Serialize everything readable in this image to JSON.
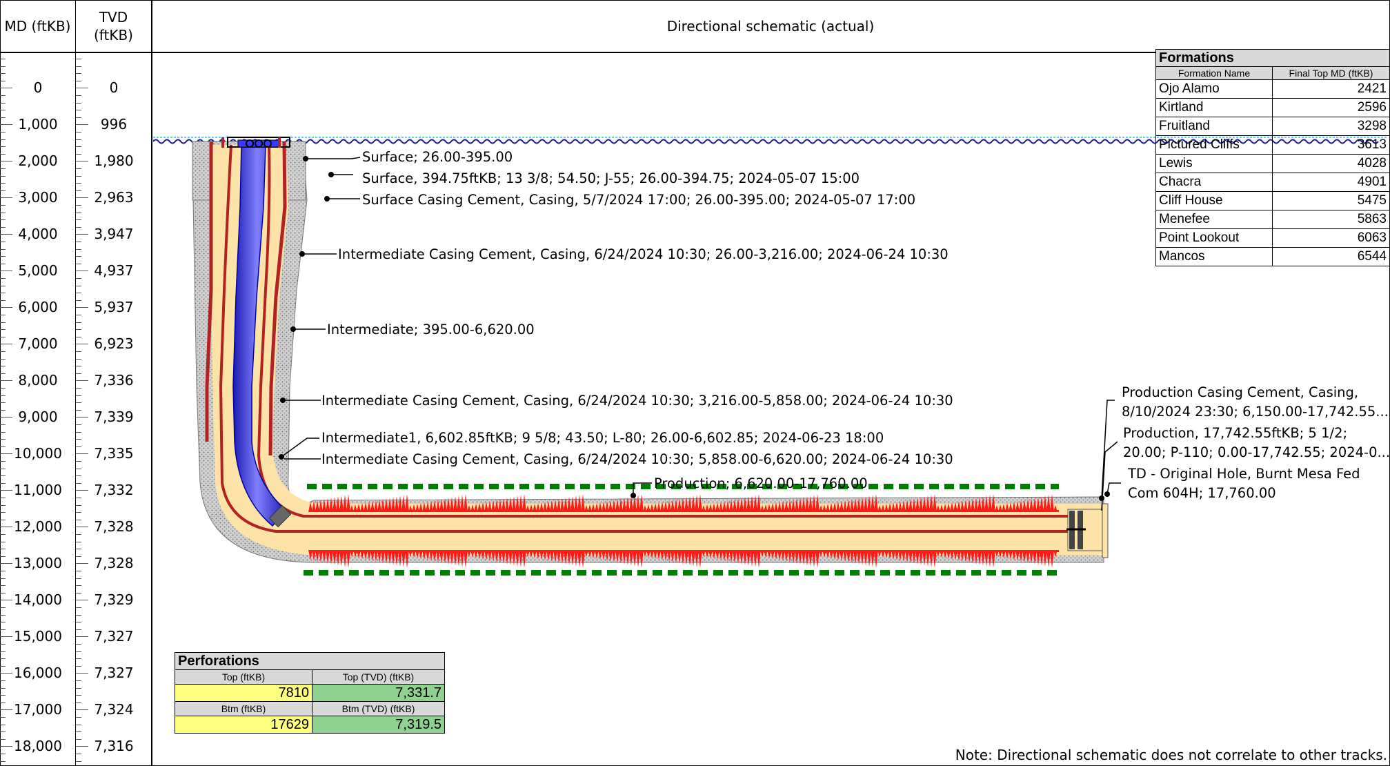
{
  "headers": {
    "md": "MD (ftKB)",
    "tvd_line1": "TVD",
    "tvd_line2": "(ftKB)",
    "schematic": "Directional schematic (actual)"
  },
  "depth_rows": [
    {
      "md": "0",
      "tvd": "0"
    },
    {
      "md": "1,000",
      "tvd": "996"
    },
    {
      "md": "2,000",
      "tvd": "1,980"
    },
    {
      "md": "3,000",
      "tvd": "2,963"
    },
    {
      "md": "4,000",
      "tvd": "3,947"
    },
    {
      "md": "5,000",
      "tvd": "4,937"
    },
    {
      "md": "6,000",
      "tvd": "5,937"
    },
    {
      "md": "7,000",
      "tvd": "6,923"
    },
    {
      "md": "8,000",
      "tvd": "7,336"
    },
    {
      "md": "9,000",
      "tvd": "7,339"
    },
    {
      "md": "10,000",
      "tvd": "7,335"
    },
    {
      "md": "11,000",
      "tvd": "7,332"
    },
    {
      "md": "12,000",
      "tvd": "7,328"
    },
    {
      "md": "13,000",
      "tvd": "7,328"
    },
    {
      "md": "14,000",
      "tvd": "7,329"
    },
    {
      "md": "15,000",
      "tvd": "7,327"
    },
    {
      "md": "16,000",
      "tvd": "7,327"
    },
    {
      "md": "17,000",
      "tvd": "7,324"
    },
    {
      "md": "18,000",
      "tvd": "7,316"
    }
  ],
  "callouts": {
    "surface_hole": "Surface; 26.00-395.00",
    "surface_casing": "Surface, 394.75ftKB; 13 3/8; 54.50; J-55; 26.00-394.75; 2024-05-07 15:00",
    "surface_cement": "Surface Casing Cement, Casing, 5/7/2024 17:00; 26.00-395.00; 2024-05-07 17:00",
    "int_cement_1": "Intermediate Casing Cement, Casing, 6/24/2024 10:30; 26.00-3,216.00; 2024-06-24 10:30",
    "intermediate_hole": "Intermediate; 395.00-6,620.00",
    "int_cement_2": "Intermediate Casing Cement, Casing, 6/24/2024 10:30; 3,216.00-5,858.00; 2024-06-24 10:30",
    "intermediate1_casing": "Intermediate1, 6,602.85ftKB; 9 5/8; 43.50; L-80; 26.00-6,602.85; 2024-06-23 18:00",
    "int_cement_3": "Intermediate Casing Cement, Casing, 6/24/2024 10:30; 5,858.00-6,620.00; 2024-06-24 10:30",
    "production_hole": "Production; 6,620.00-17,760.00",
    "prod_cement_l1": "Production Casing Cement, Casing,",
    "prod_cement_l2": "8/10/2024  23:30;  6,150.00-17,742.55...",
    "prod_casing_l1": "Production, 17,742.55ftKB; 5 1/2;",
    "prod_casing_l2": "20.00;  P-110;  0.00-17,742.55;  2024-0...",
    "td_l1": "TD - Original Hole, Burnt Mesa Fed",
    "td_l2": "Com 604H; 17,760.00"
  },
  "formations": {
    "title": "Formations",
    "col_name": "Formation Name",
    "col_top": "Final Top MD (ftKB)",
    "rows": [
      {
        "name": "Ojo Alamo",
        "top": "2421"
      },
      {
        "name": "Kirtland",
        "top": "2596"
      },
      {
        "name": "Fruitland",
        "top": "3298"
      },
      {
        "name": "Pictured Cliffs",
        "top": "3613"
      },
      {
        "name": "Lewis",
        "top": "4028"
      },
      {
        "name": "Chacra",
        "top": "4901"
      },
      {
        "name": "Cliff House",
        "top": "5475"
      },
      {
        "name": "Menefee",
        "top": "5863"
      },
      {
        "name": "Point Lookout",
        "top": "6063"
      },
      {
        "name": "Mancos",
        "top": "6544"
      }
    ]
  },
  "perforations": {
    "title": "Perforations",
    "col_top": "Top (ftKB)",
    "col_top_tvd": "Top (TVD) (ftKB)",
    "top": "7810",
    "top_tvd": "7,331.7",
    "col_btm": "Btm (ftKB)",
    "col_btm_tvd": "Btm (TVD) (ftKB)",
    "btm": "17629",
    "btm_tvd": "7,319.5"
  },
  "note": "Note: Directional schematic does not correlate to other tracks.",
  "colors": {
    "cement": "#c8c8c8",
    "annulus": "#fde3a7",
    "casing": "#b22222",
    "tubing": "#3b3bff",
    "perforation": "#ff1a1a",
    "formation_marker": "#008000",
    "water_line": "#1a1aa0"
  }
}
